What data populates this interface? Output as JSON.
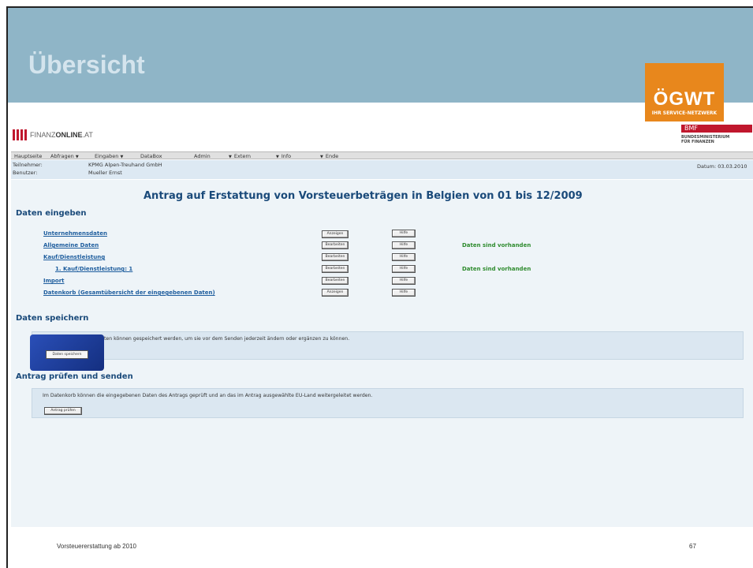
{
  "slide": {
    "title": "Übersicht",
    "footer_text": "Vorsteuererstattung ab 2010",
    "page_number": "67"
  },
  "logos": {
    "oegwt": {
      "name": "ÖGWT",
      "tagline": "IHR SERVICE-NETZWERK",
      "color": "#e8871c"
    },
    "finanzonline": {
      "prefix": "FINANZ",
      "bold": "ONLINE",
      "suffix": ".AT",
      "color": "#c0172d"
    },
    "bmf": {
      "name": "BMF",
      "subline1": "BUNDESMINISTERIUM",
      "subline2": "FÜR FINANZEN"
    }
  },
  "menu": {
    "items": [
      {
        "label": "Hauptseite",
        "arrow": false
      },
      {
        "label": "Abfragen",
        "arrow": true
      },
      {
        "label": "Eingaben",
        "arrow": true
      },
      {
        "label": "DataBox",
        "arrow": false
      },
      {
        "label": "Admin",
        "arrow": true
      },
      {
        "label": "Extern",
        "arrow": true
      },
      {
        "label": "Info",
        "arrow": true
      },
      {
        "label": "Ende",
        "arrow": false
      }
    ]
  },
  "user_info": {
    "teilnehmer_label": "Teilnehmer:",
    "teilnehmer_value": "KPMG Alpen-Treuhand GmbH",
    "benutzer_label": "Benutzer:",
    "benutzer_value": "Mueller Ernst",
    "datum": "Datum: 03.03.2010"
  },
  "main": {
    "title": "Antrag auf Erstattung von Vorsteuerbeträgen in Belgien von 01 bis 12/2009",
    "section_input": "Daten eingeben",
    "rows": [
      {
        "label": "Unternehmensdaten",
        "button": "Anzeigen",
        "help": "Hilfe",
        "status": ""
      },
      {
        "label": "Allgemeine Daten",
        "button": "Bearbeiten",
        "help": "Hilfe",
        "status": "Daten sind vorhanden"
      },
      {
        "label": "Kauf/Dienstleistung",
        "button": "Bearbeiten",
        "help": "Hilfe",
        "status": ""
      },
      {
        "label": "1. Kauf/Dienstleistung: 1",
        "button": "Bearbeiten",
        "help": "Hilfe",
        "status": "Daten sind vorhanden"
      },
      {
        "label": "Import",
        "button": "Bearbeiten",
        "help": "Hilfe",
        "status": ""
      },
      {
        "label": "Datenkorb (Gesamtübersicht der eingegebenen Daten)",
        "button": "Anzeigen",
        "help": "Hilfe",
        "status": ""
      }
    ],
    "section_save": "Daten speichern",
    "save_text": "ten können gespeichert werden, um sie vor dem Senden jederzeit ändern oder ergänzen zu können.",
    "save_button": "Daten speichern",
    "section_check": "Antrag prüfen und senden",
    "check_text": "Im Datenkorb können die eingegebenen Daten des Antrags geprüft und an das im Antrag ausgewählte EU-Land weitergeleitet werden.",
    "check_button": "Antrag prüfen"
  }
}
